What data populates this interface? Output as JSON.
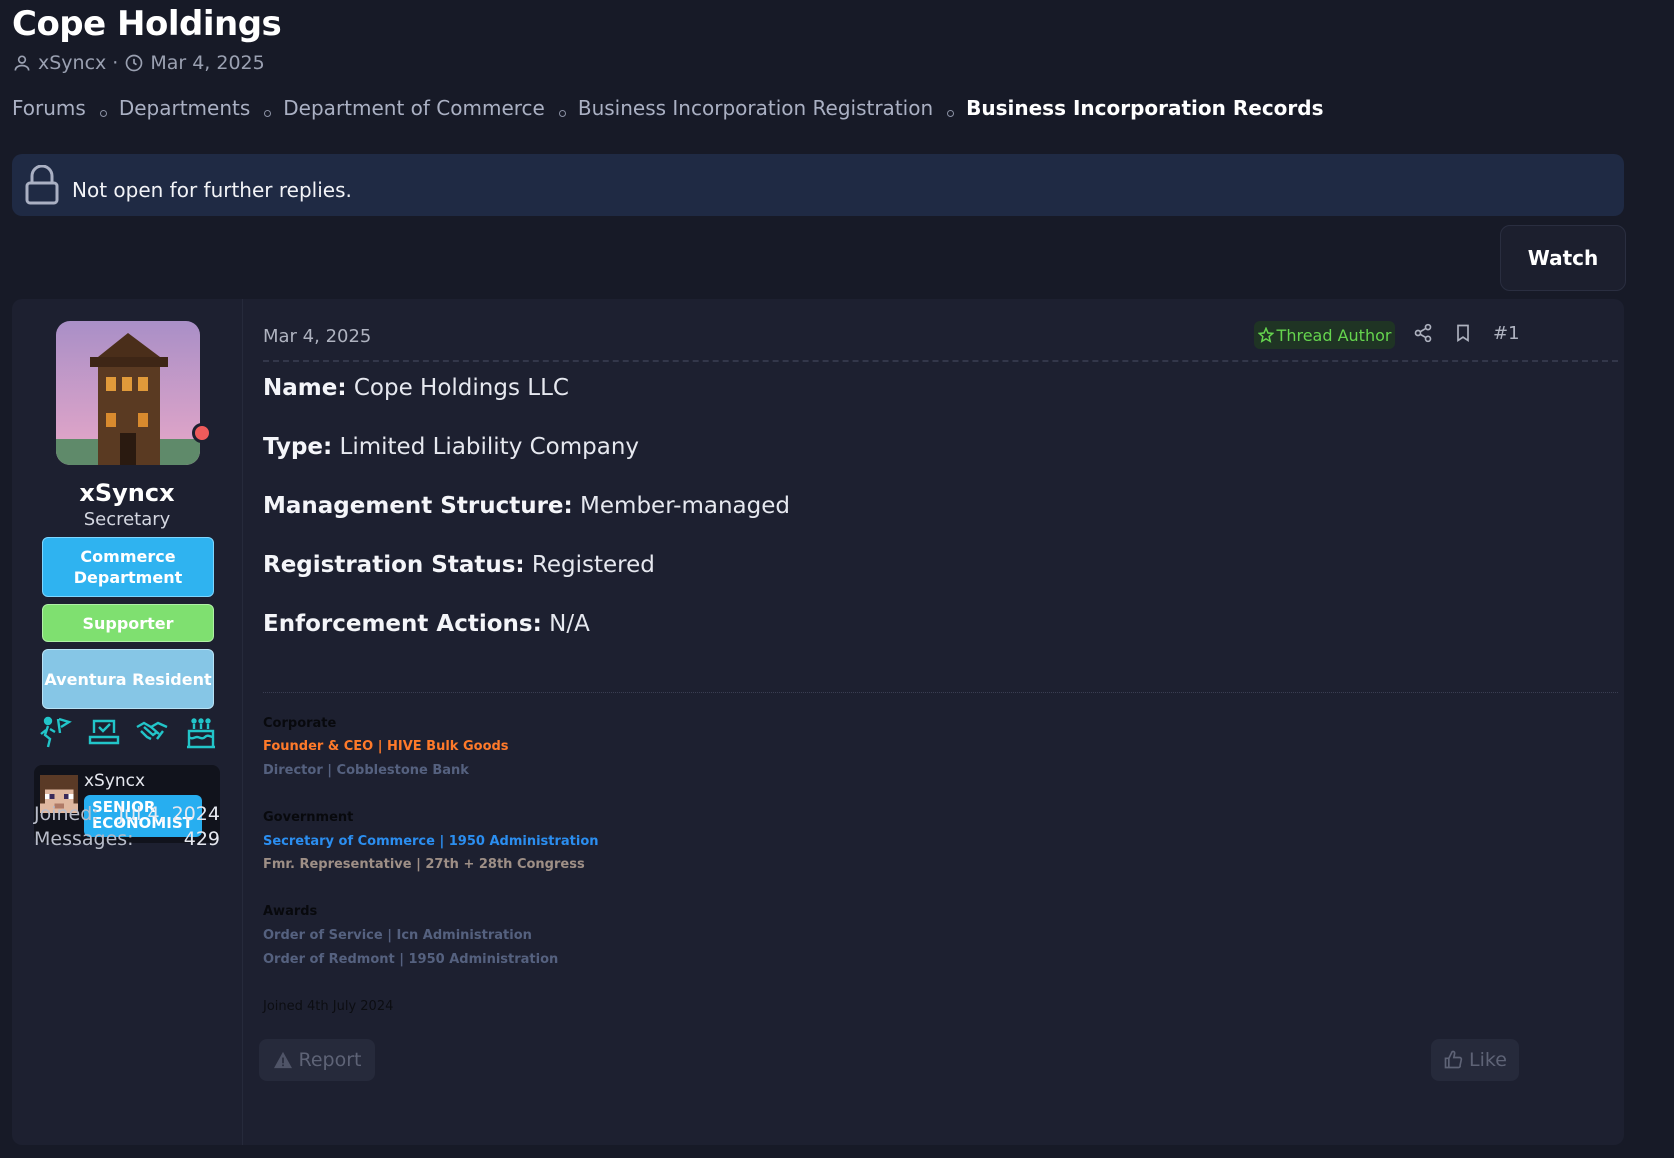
{
  "thread": {
    "title": "Cope Holdings",
    "author": "xSyncx",
    "date": "Mar 4, 2025"
  },
  "breadcrumbs": [
    "Forums",
    "Departments",
    "Department of Commerce",
    "Business Incorporation Registration",
    "Business Incorporation Records"
  ],
  "notice": "Not open for further replies.",
  "watch_label": "Watch",
  "user": {
    "name": "xSyncx",
    "title": "Secretary",
    "badges": [
      "Commerce Department",
      "Supporter",
      "Aventura Resident"
    ],
    "mc_name": "xSyncx",
    "mc_role": "SENIOR ECONOMIST",
    "joined_label": "Joined:",
    "joined": "Jul 4, 2024",
    "messages_label": "Messages:",
    "messages": "429"
  },
  "post": {
    "date": "Mar 4, 2025",
    "author_badge": "Thread Author",
    "number": "#1",
    "fields": [
      {
        "label": "Name:",
        "value": "Cope Holdings LLC"
      },
      {
        "label": "Type:",
        "value": "Limited Liability Company"
      },
      {
        "label": "Management Structure:",
        "value": "Member-managed"
      },
      {
        "label": "Registration Status:",
        "value": "Registered"
      },
      {
        "label": "Enforcement Actions:",
        "value": "N/A"
      }
    ],
    "signature": {
      "corporate_heading": "Corporate",
      "corporate": [
        "Founder & CEO | HIVE Bulk Goods",
        "Director | Cobblestone Bank"
      ],
      "government_heading": "Government",
      "government": [
        "Secretary of Commerce | 1950 Administration",
        "Fmr. Representative | 27th + 28th Congress"
      ],
      "awards_heading": "Awards",
      "awards": [
        "Order of Service | Icn Administration",
        "Order of Redmont | 1950 Administration"
      ],
      "joined_note": "Joined 4th July 2024"
    },
    "report_label": "Report",
    "like_label": "Like"
  }
}
